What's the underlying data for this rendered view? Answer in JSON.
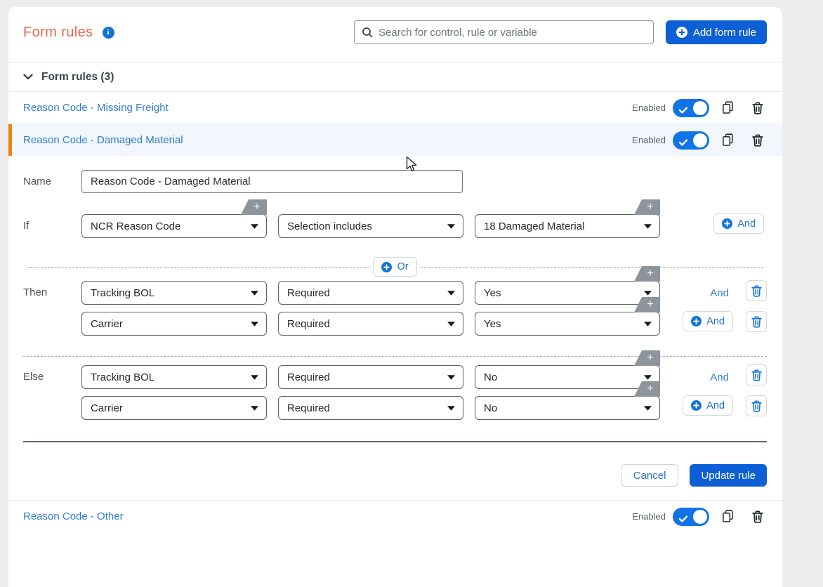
{
  "header": {
    "title": "Form rules"
  },
  "search": {
    "placeholder": "Search for control, rule or variable"
  },
  "actions": {
    "add_form_rule": "Add form rule"
  },
  "section": {
    "title": "Form rules (3)"
  },
  "rules": [
    {
      "title": "Reason Code - Missing Freight",
      "status_label": "Enabled"
    },
    {
      "title": "Reason Code - Damaged Material",
      "status_label": "Enabled"
    },
    {
      "title": "Reason Code - Other",
      "status_label": "Enabled"
    }
  ],
  "editor": {
    "name_label": "Name",
    "name_value": "Reason Code - Damaged Material",
    "if_label": "If",
    "if": {
      "control": "NCR Reason Code",
      "operator": "Selection includes",
      "value": "18 Damaged Material"
    },
    "or_label": "Or",
    "and_label": "And",
    "then_label": "Then",
    "then": [
      {
        "control": "Tracking BOL",
        "operator": "Required",
        "value": "Yes"
      },
      {
        "control": "Carrier",
        "operator": "Required",
        "value": "Yes"
      }
    ],
    "else_label": "Else",
    "else": [
      {
        "control": "Tracking BOL",
        "operator": "Required",
        "value": "No"
      },
      {
        "control": "Carrier",
        "operator": "Required",
        "value": "No"
      }
    ],
    "cancel_button": "Cancel",
    "update_button": "Update rule"
  },
  "colors": {
    "accent_orange": "#e7694a",
    "selected_border_orange": "#e8860f",
    "link_blue": "#2f7dd1",
    "primary_blue": "#0d5fd6",
    "toggle_blue": "#1273e6"
  }
}
